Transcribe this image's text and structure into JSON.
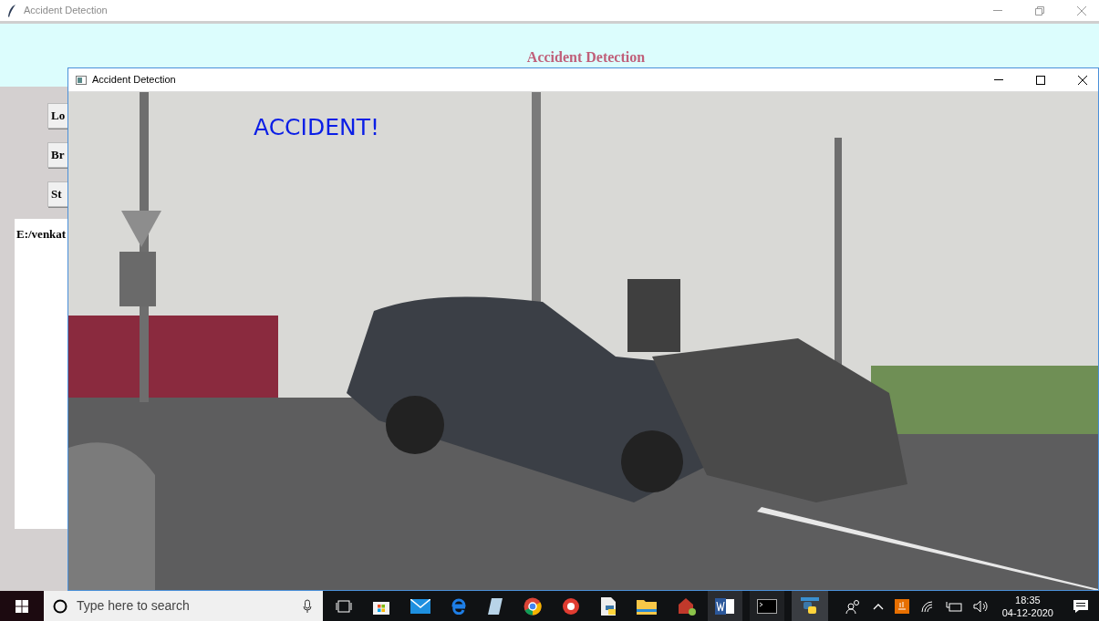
{
  "window": {
    "title": "Accident Detection"
  },
  "header": {
    "title": "Accident Detection"
  },
  "buttons": [
    "Lo",
    "Br",
    "St"
  ],
  "path_box": {
    "text": "E:/venkat"
  },
  "video_window": {
    "title": "Accident Detection",
    "overlay_text": "ACCIDENT!"
  },
  "taskbar": {
    "search": {
      "placeholder": "Type here to search"
    },
    "time": "18:35",
    "date": "04-12-2020"
  }
}
